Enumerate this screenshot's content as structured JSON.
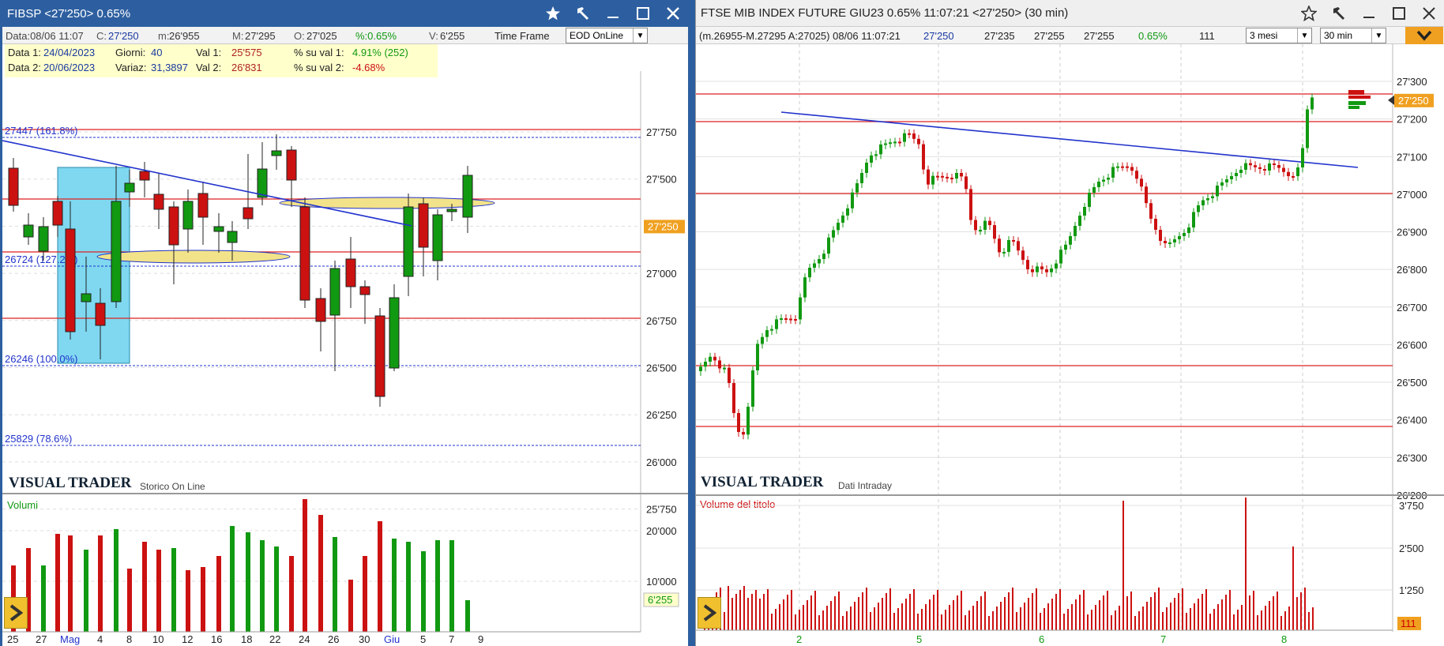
{
  "left": {
    "title": "FIBSP <27'250> 0.65%",
    "info": {
      "data": "Data:08/06 11:07",
      "c_lbl": "C:",
      "c": "27'250",
      "m_lbl": "m:",
      "m": "26'955",
      "M_lbl": "M:",
      "M": "27'295",
      "o_lbl": "O:",
      "o": "27'025",
      "pct": "%:0.65%",
      "v_lbl": "V:",
      "v": "6'255",
      "tf_lbl": "Time Frame",
      "tf": "EOD OnLine"
    },
    "box": {
      "d1_lbl": "Data 1:",
      "d1": "24/04/2023",
      "giorni_lbl": "Giorni:",
      "giorni": "40",
      "val1_lbl": "Val 1:",
      "val1": "25'575",
      "psv1_lbl": "% su val 1:",
      "psv1": "4.91% (252)",
      "d2_lbl": "Data 2:",
      "d2": "20/06/2023",
      "variaz_lbl": "Variaz:",
      "variaz": "31,3897",
      "val2_lbl": "Val 2:",
      "val2": "26'831",
      "psv2_lbl": "% su val 2:",
      "psv2": "-4.68%"
    },
    "fib": [
      "27447 (161.8%)",
      "26724 (127.2%)",
      "26246 (100.0%)",
      "25829 (78.6%)"
    ],
    "price_ticks": [
      "27'750",
      "27'500",
      "27'000",
      "26'750",
      "26'500",
      "26'250",
      "26'000",
      "25'750"
    ],
    "price_tag": "27'250",
    "brand": "VISUAL TRADER",
    "brand_sub": "Storico On Line",
    "vol_title": "Volumi",
    "vol_ticks": [
      "20'000",
      "10'000"
    ],
    "vol_tag": "6'255",
    "x_labels": [
      "25",
      "27",
      "Mag",
      "4",
      "8",
      "10",
      "12",
      "16",
      "18",
      "22",
      "24",
      "26",
      "30",
      "Giu",
      "5",
      "7",
      "9"
    ]
  },
  "right": {
    "title": "FTSE MIB INDEX FUTURE GIU23 0.65% 11:07:21 <27'250> (30 min)",
    "info": {
      "range": "(m.26955-M.27295 A:27025) 08/06 11:07:21",
      "last": "27'250",
      "a": "27'235",
      "b": "27'255",
      "c": "27'255",
      "pct": "0.65%",
      "vol": "111",
      "period": "3 mesi",
      "interval": "30 min"
    },
    "price_ticks": [
      "27'300",
      "27'200",
      "27'100",
      "27'000",
      "26'900",
      "26'800",
      "26'700",
      "26'600",
      "26'500",
      "26'400",
      "26'300",
      "26'200"
    ],
    "price_tag": "27'250",
    "brand": "VISUAL TRADER",
    "brand_sub": "Dati Intraday",
    "vol_title": "Volume del titolo",
    "vol_ticks": [
      "3'750",
      "2'500",
      "1'250"
    ],
    "vol_tag": "111",
    "x_labels": [
      "2",
      "5",
      "6",
      "7",
      "8"
    ]
  },
  "colors": {
    "up": "#119911",
    "down": "#cc1111",
    "trend": "#2233cc",
    "hline": "#dd2222",
    "fib": "#2233cc",
    "highlight": "#7fd8f0",
    "tag": "#f0a020"
  }
}
